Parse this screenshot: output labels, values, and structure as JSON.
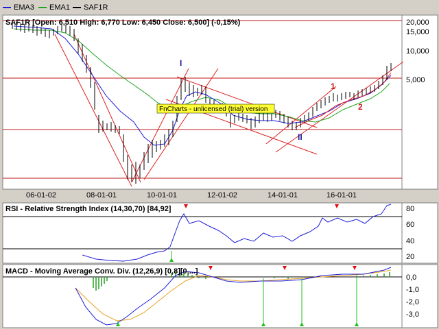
{
  "legend": [
    {
      "name": "EMA3",
      "color": "#1c1cd8"
    },
    {
      "name": "EMA1",
      "color": "#1ea51e"
    },
    {
      "name": "SAF1R",
      "color": "#000000"
    }
  ],
  "main_panel": {
    "header": "SAF1R [Open: 6,510  High: 6,770  Low: 6,450  Close: 6,500] (-0,15%)",
    "watermark": "FnCharts - unlicensed (trial) version",
    "wave_labels": [
      "I",
      "II",
      "1",
      "2"
    ],
    "y_ticks": [
      "20,000",
      "15,000",
      "10,000",
      "5,000"
    ],
    "x_ticks": [
      "06-01-02",
      "08-01-01",
      "10-01-01",
      "12-01-02",
      "14-01-01",
      "16-01-01"
    ]
  },
  "rsi_panel": {
    "header": "RSI - Relative Strength Index (14,30,70) [84,92]",
    "y_ticks": [
      "80",
      "60",
      "40",
      "20"
    ]
  },
  "macd_panel": {
    "header": "MACD - Moving Average Conv. Div. (12,26,9) [0,8][0,...]",
    "y_ticks": [
      "0,0",
      "-1,0",
      "-2,0",
      "-3,0"
    ]
  },
  "colors": {
    "background": "#ffffff",
    "frame": "#d4d0c8",
    "ema3": "#1c1cd8",
    "ema1": "#1ea51e",
    "trendline": "#e02020",
    "signal": "#e8a020",
    "up_marker": "#20c020",
    "down_marker": "#e01010"
  }
}
